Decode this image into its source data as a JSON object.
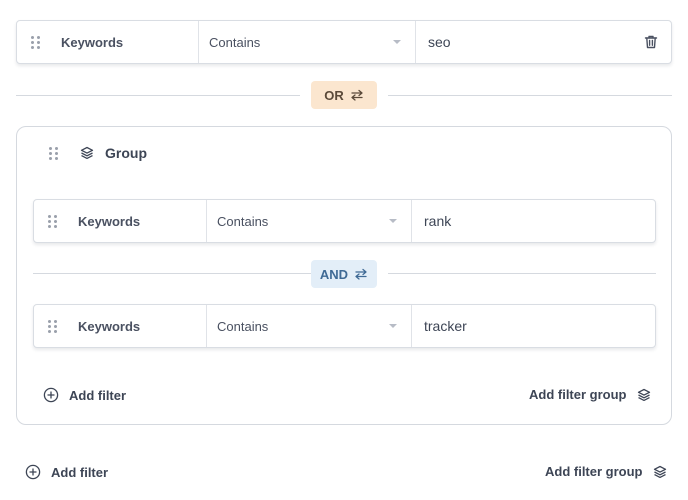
{
  "top_filter": {
    "field": "Keywords",
    "operator": "Contains",
    "value": "seo"
  },
  "outer_connector": {
    "label": "OR"
  },
  "group": {
    "title": "Group",
    "filters": [
      {
        "field": "Keywords",
        "operator": "Contains",
        "value": "rank"
      },
      {
        "field": "Keywords",
        "operator": "Contains",
        "value": "tracker"
      }
    ],
    "connector": {
      "label": "AND"
    },
    "add_filter_label": "Add filter",
    "add_filter_group_label": "Add filter group"
  },
  "footer": {
    "add_filter_label": "Add filter",
    "add_filter_group_label": "Add filter group"
  },
  "colors": {
    "or_bg": "#fbe6cf",
    "and_bg": "#e3eef8",
    "border": "#d9dde3"
  },
  "icons": [
    "drag-handle-icon",
    "trash-icon",
    "swap-arrows-icon",
    "layers-icon",
    "plus-circle-icon",
    "chevron-down-icon"
  ]
}
